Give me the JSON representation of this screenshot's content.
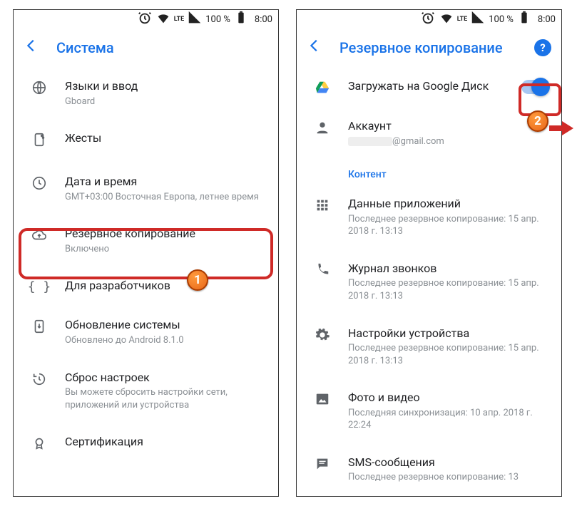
{
  "status": {
    "battery": "100 %",
    "time": "8:00",
    "net": "LTE"
  },
  "left": {
    "title": "Система",
    "items": [
      {
        "title": "Языки и ввод",
        "sub": "Gboard"
      },
      {
        "title": "Жесты",
        "sub": ""
      },
      {
        "title": "Дата и время",
        "sub": "GMT+03:00 Восточная Европа, летнее время"
      },
      {
        "title": "Резервное копирование",
        "sub": "Включено"
      },
      {
        "title": "Для разработчиков",
        "sub": ""
      },
      {
        "title": "Обновление системы",
        "sub": "Обновлено до Android 8.1.0"
      },
      {
        "title": "Сброс настроек",
        "sub": "Вы можете сбросить настройки сети, приложений или устройства"
      },
      {
        "title": "Сертификация",
        "sub": ""
      }
    ]
  },
  "right": {
    "title": "Резервное копирование",
    "backup_to_drive": "Загружать на Google Диск",
    "account_label": "Аккаунт",
    "account_email_suffix": "@gmail.com",
    "content_header": "Контент",
    "items": [
      {
        "title": "Данные приложений",
        "sub": "Последнее резервное копирование: 15 апр. 2018 г. 13:13"
      },
      {
        "title": "Журнал звонков",
        "sub": "Последнее резервное копирование: 15 апр. 2018 г. 13:13"
      },
      {
        "title": "Настройки устройства",
        "sub": "Последнее резервное копирование: 15 апр. 2018 г. 13:13"
      },
      {
        "title": "Фото и видео",
        "sub": "Последняя синхронизация: 10 апр. 2018 г. 22:24"
      },
      {
        "title": "SMS-сообщения",
        "sub": "Последнее резервное копирование: 13"
      }
    ]
  },
  "annotations": {
    "callout1": "1",
    "callout2": "2"
  }
}
